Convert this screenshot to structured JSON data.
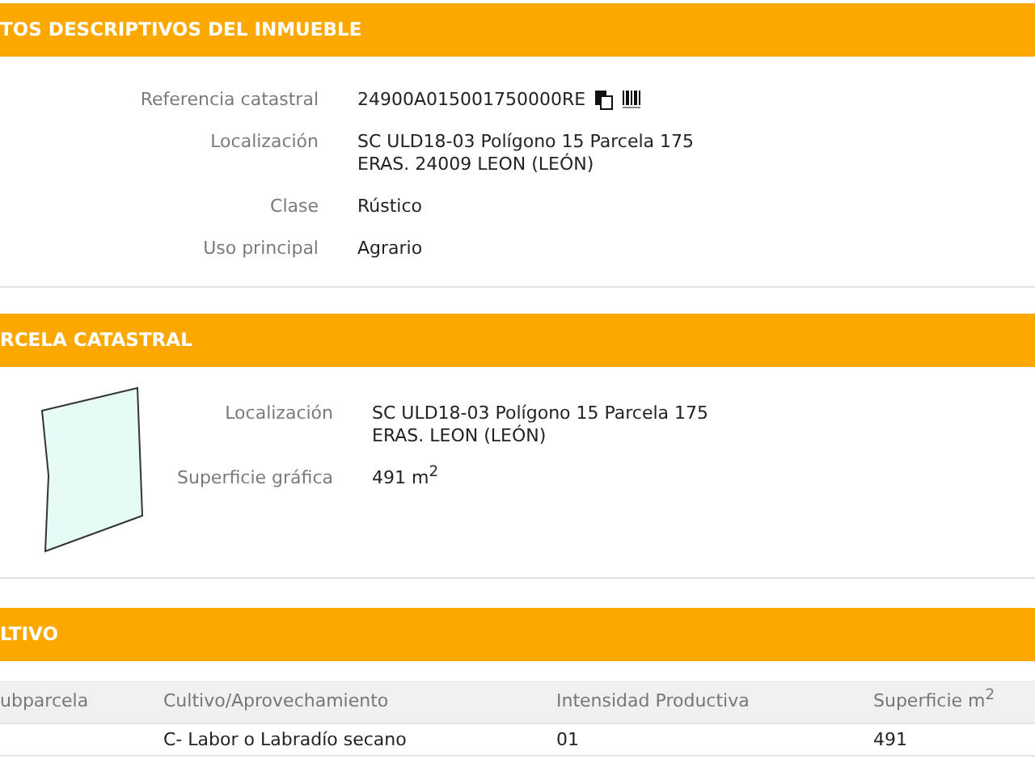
{
  "sections": [
    {
      "kind": "fields",
      "title": "TOS DESCRIPTIVOS DEL INMUEBLE",
      "fields": [
        {
          "label": "Referencia catastral",
          "lines": [
            "24900A015001750000RE"
          ],
          "icons": true
        },
        {
          "label": "Localización",
          "lines": [
            "SC ULD18-03 Polígono 15 Parcela 175",
            "ERAS. 24009 LEON (LEÓN)"
          ]
        },
        {
          "label": "Clase",
          "lines": [
            "Rústico"
          ]
        },
        {
          "label": "Uso principal",
          "lines": [
            "Agrario"
          ]
        }
      ]
    },
    {
      "kind": "parcel",
      "title": "RCELA CATASTRAL",
      "fields": [
        {
          "label": "Localización",
          "lines": [
            "SC ULD18-03 Polígono 15 Parcela 175",
            "ERAS. LEON (LEÓN)"
          ]
        },
        {
          "label": "Superficie gráfica",
          "lines": [
            "491 m$^{2}$"
          ]
        }
      ]
    },
    {
      "kind": "table",
      "title": "LTIVO",
      "columns": [
        "ubparcela",
        "Cultivo/Aprovechamiento",
        "Intensidad Productiva",
        "Superficie m$^{2}$"
      ],
      "rows": [
        [
          "",
          "C- Labor o Labradío secano",
          "01",
          "491"
        ]
      ]
    }
  ]
}
